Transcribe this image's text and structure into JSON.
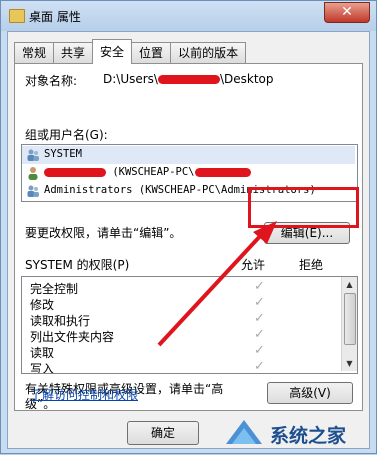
{
  "window": {
    "title": "桌面 属性",
    "close_label": "✕"
  },
  "tabs": [
    {
      "label": "常规"
    },
    {
      "label": "共享"
    },
    {
      "label": "安全",
      "active": true
    },
    {
      "label": "位置"
    },
    {
      "label": "以前的版本"
    }
  ],
  "object_name": {
    "label": "对象名称:",
    "value_prefix": "D:\\Users\\",
    "value_suffix": "\\Desktop"
  },
  "groups": {
    "label": "组或用户名(G):",
    "items": [
      {
        "name": "SYSTEM",
        "icon": "users-icon"
      },
      {
        "name_suffix": "(KWSCHEAP-PC\\",
        "icon": "user-icon"
      },
      {
        "name": "Administrators (KWSCHEAP-PC\\Administrators)",
        "icon": "users-icon"
      }
    ]
  },
  "change_perm": {
    "text": "要更改权限，请单击“编辑”。",
    "edit_label": "编辑(E)..."
  },
  "permissions": {
    "header": "SYSTEM 的权限(P)",
    "allow_label": "允许",
    "deny_label": "拒绝",
    "items": [
      {
        "name": "完全控制",
        "allow": true
      },
      {
        "name": "修改",
        "allow": true
      },
      {
        "name": "读取和执行",
        "allow": true
      },
      {
        "name": "列出文件夹内容",
        "allow": true
      },
      {
        "name": "读取",
        "allow": true
      },
      {
        "name": "写入",
        "allow": true
      }
    ]
  },
  "advanced": {
    "text_line1": "有关特殊权限或高级设置，请单击“高",
    "text_line2": "级”。",
    "button_label": "高级(V)"
  },
  "link_text": "了解访问控制和权限",
  "footer": {
    "ok_label": "确定"
  },
  "watermark": {
    "text": "系统之家"
  },
  "colors": {
    "highlight": "#e0141c",
    "link": "#0645ad"
  }
}
